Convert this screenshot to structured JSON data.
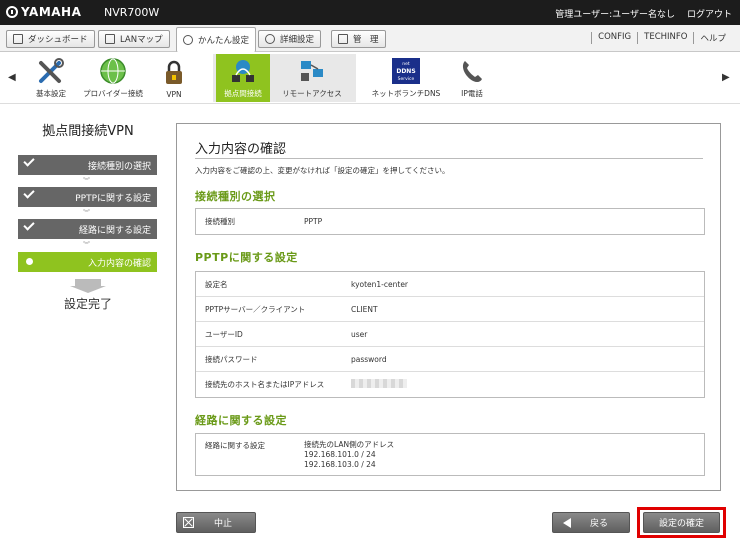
{
  "header": {
    "brand": "YAMAHA",
    "model": "NVR700W",
    "user_label": "管理ユーザー:ユーザー名なし",
    "logout": "ログアウト"
  },
  "tabs": {
    "dashboard": "ダッシュボード",
    "lanmap": "LANマップ",
    "easy": "かんたん設定",
    "detail": "詳細設定",
    "admin": "管　理",
    "config": "CONFIG",
    "techinfo": "TECHINFO",
    "help": "ヘルプ"
  },
  "nav": {
    "basic": "基本設定",
    "provider": "プロバイダー接続",
    "vpn": "VPN",
    "site": "拠点間接続",
    "remote": "リモートアクセス",
    "ddns": "ネットボランチDNS",
    "ip_phone": "IP電話",
    "ddns_badge_top": "net",
    "ddns_badge_mid": "DDNS",
    "ddns_badge_bot": "Service"
  },
  "wizard": {
    "title": "拠点間接続VPN",
    "steps": [
      {
        "label": "接続種別の選択",
        "state": "done"
      },
      {
        "label": "PPTPに関する設定",
        "state": "done"
      },
      {
        "label": "経路に関する設定",
        "state": "done"
      },
      {
        "label": "入力内容の確認",
        "state": "current"
      }
    ],
    "chevron": "︾",
    "complete": "設定完了"
  },
  "main": {
    "title": "入力内容の確認",
    "intro": "入力内容をご確認の上、変更がなければ「設定の確定」を押してください。",
    "section_type": {
      "heading": "接続種別の選択",
      "rows": [
        {
          "key": "接続種別",
          "value": "PPTP"
        }
      ]
    },
    "section_pptp": {
      "heading": "PPTPに関する設定",
      "rows": [
        {
          "key": "設定名",
          "value": "kyoten1-center"
        },
        {
          "key": "PPTPサーバー／クライアント",
          "value": "CLIENT"
        },
        {
          "key": "ユーザーID",
          "value": "user"
        },
        {
          "key": "接続パスワード",
          "value": "password"
        },
        {
          "key": "接続先のホスト名またはIPアドレス",
          "value": ""
        }
      ]
    },
    "section_route": {
      "heading": "経路に関する設定",
      "key": "経路に関する設定",
      "value_title": "接続先のLAN側のアドレス",
      "addresses": [
        "192.168.101.0 / 24",
        "192.168.103.0 / 24"
      ]
    }
  },
  "buttons": {
    "cancel": "中止",
    "back": "戻る",
    "confirm": "設定の確定"
  },
  "colors": {
    "accent_green": "#8fc31f",
    "heading_green": "#6a9a18",
    "highlight_red": "#e00000"
  }
}
